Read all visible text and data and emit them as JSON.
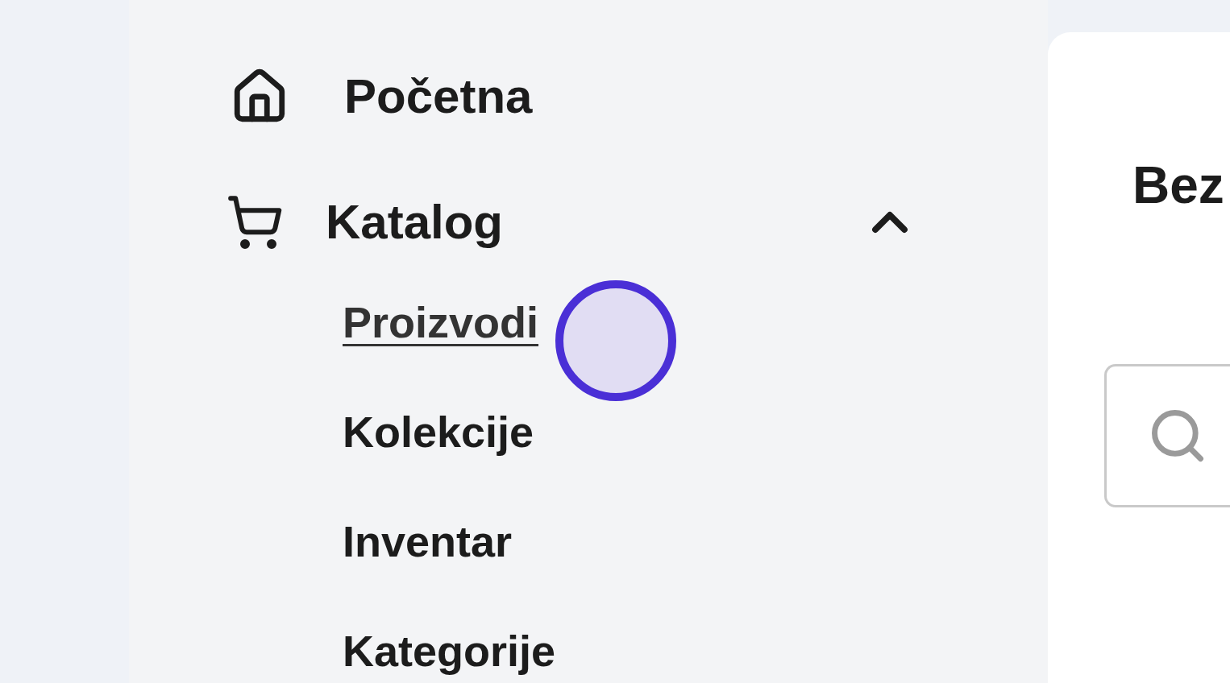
{
  "sidebar": {
    "items": [
      {
        "label": "Početna",
        "kind": "home"
      },
      {
        "label": "Katalog",
        "kind": "cart",
        "expanded": true,
        "children": [
          {
            "label": "Proizvodi",
            "selected": true
          },
          {
            "label": "Kolekcije",
            "selected": false
          },
          {
            "label": "Inventar",
            "selected": false
          },
          {
            "label": "Kategorije",
            "selected": false
          }
        ]
      }
    ]
  },
  "main": {
    "heading": "Bez"
  },
  "cursor": {
    "visible": true
  }
}
